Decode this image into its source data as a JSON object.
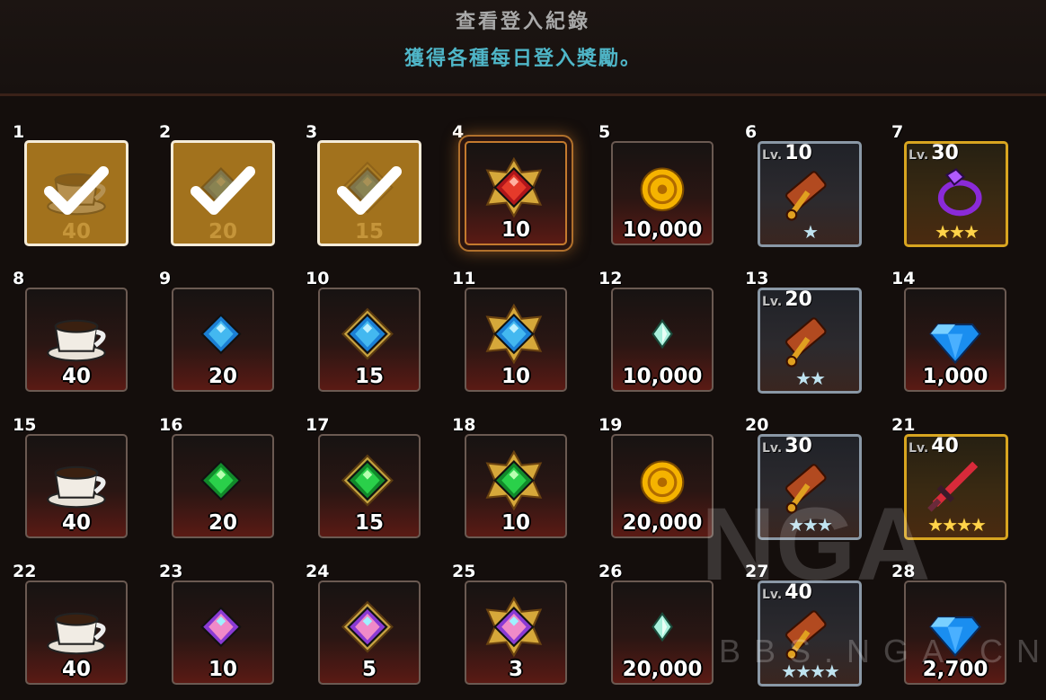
{
  "header": {
    "title": "查看登入紀錄",
    "subtitle": "獲得各種每日登入獎勵。"
  },
  "days": [
    {
      "day": "1",
      "qty": "40",
      "icon": "coffee-icon",
      "state": "claimed"
    },
    {
      "day": "2",
      "qty": "20",
      "icon": "blue-gem-icon",
      "state": "claimed"
    },
    {
      "day": "3",
      "qty": "15",
      "icon": "blue-gem-framed-icon",
      "state": "claimed"
    },
    {
      "day": "4",
      "qty": "10",
      "icon": "red-gem-framed-icon",
      "state": "today"
    },
    {
      "day": "5",
      "qty": "10,000",
      "icon": "gold-coin-icon",
      "state": "normal"
    },
    {
      "day": "6",
      "lv": "10",
      "stars": "★",
      "icon": "hammer-icon",
      "state": "blue"
    },
    {
      "day": "7",
      "lv": "30",
      "stars": "★★★",
      "icon": "purple-ring-icon",
      "state": "gold"
    },
    {
      "day": "8",
      "qty": "40",
      "icon": "coffee-icon",
      "state": "normal"
    },
    {
      "day": "9",
      "qty": "20",
      "icon": "blue-gem-icon",
      "state": "normal"
    },
    {
      "day": "10",
      "qty": "15",
      "icon": "blue-gem-framed-icon",
      "state": "normal"
    },
    {
      "day": "11",
      "qty": "10",
      "icon": "blue-gem-ornate-icon",
      "state": "normal"
    },
    {
      "day": "12",
      "qty": "10,000",
      "icon": "crystal-shard-icon",
      "state": "normal"
    },
    {
      "day": "13",
      "lv": "20",
      "stars": "★★",
      "icon": "hammer-icon",
      "state": "blue"
    },
    {
      "day": "14",
      "qty": "1,000",
      "icon": "diamond-icon",
      "state": "normal"
    },
    {
      "day": "15",
      "qty": "40",
      "icon": "coffee-icon",
      "state": "normal"
    },
    {
      "day": "16",
      "qty": "20",
      "icon": "green-gem-icon",
      "state": "normal"
    },
    {
      "day": "17",
      "qty": "15",
      "icon": "green-gem-framed-icon",
      "state": "normal"
    },
    {
      "day": "18",
      "qty": "10",
      "icon": "green-gem-ornate-icon",
      "state": "normal"
    },
    {
      "day": "19",
      "qty": "20,000",
      "icon": "gold-coin-icon",
      "state": "normal"
    },
    {
      "day": "20",
      "lv": "30",
      "stars": "★★★",
      "icon": "hammer-icon",
      "state": "blue"
    },
    {
      "day": "21",
      "lv": "40",
      "stars": "★★★★",
      "icon": "red-sword-icon",
      "state": "gold"
    },
    {
      "day": "22",
      "qty": "40",
      "icon": "coffee-icon",
      "state": "normal"
    },
    {
      "day": "23",
      "qty": "10",
      "icon": "rainbow-gem-icon",
      "state": "normal"
    },
    {
      "day": "24",
      "qty": "5",
      "icon": "rainbow-gem-framed-icon",
      "state": "normal"
    },
    {
      "day": "25",
      "qty": "3",
      "icon": "rainbow-gem-ornate-icon",
      "state": "normal"
    },
    {
      "day": "26",
      "qty": "20,000",
      "icon": "crystal-shard-icon",
      "state": "normal"
    },
    {
      "day": "27",
      "lv": "40",
      "stars": "★★★★",
      "icon": "hammer-icon",
      "state": "blue"
    },
    {
      "day": "28",
      "qty": "2,700",
      "icon": "diamond-icon",
      "state": "normal"
    }
  ],
  "lv_prefix": "Lv.",
  "watermark": {
    "logo": "NGA",
    "site": "BBS.NGA.CN"
  },
  "colors": {
    "claimed": "#a2721d",
    "accent_text": "#4fb6c8",
    "gold_frame": "#d8a520",
    "blue_frame": "#8a98a6"
  }
}
